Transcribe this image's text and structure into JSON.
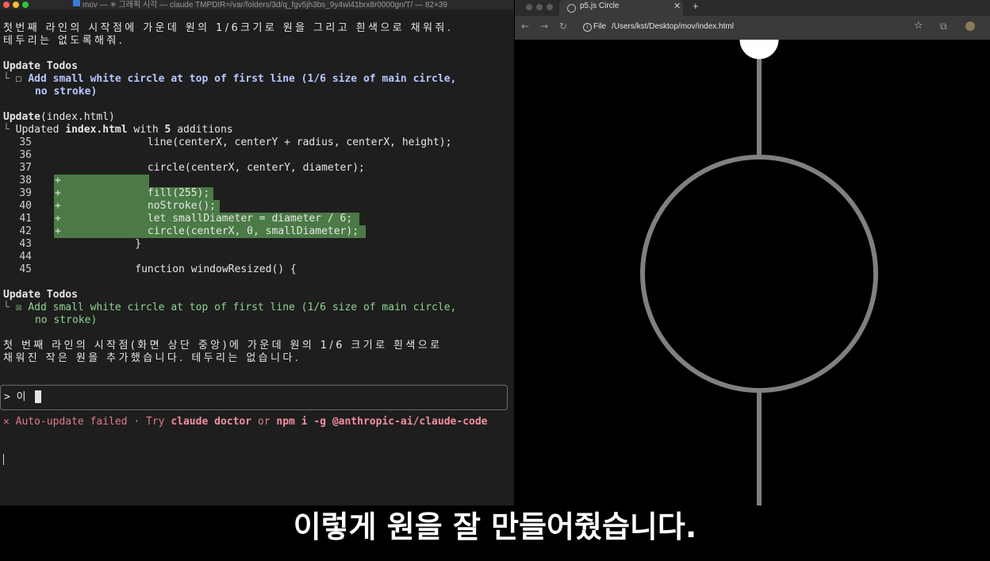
{
  "terminal": {
    "title": "mov — ✳ 그래픽 시각 — claude TMPDIR=/var/folders/3d/q_fgv5jh3bs_9y4wl41brx8r0000gn/T/ — 82×39",
    "request_line1": "첫번째 라인의 시작점에 가운데 원의 1/6크기로 원을 그리고 흰색으로 채워줘.",
    "request_line2": "테두리는 없도록해줘.",
    "todos1_header": "Update Todos",
    "todos1_box": "☐",
    "todos1_item_line1": "Add small white circle at top of first line (1/6 size of main circle,",
    "todos1_item_line2": "no stroke)",
    "update_label": "Update",
    "update_file": "(index.html)",
    "updated_prefix": "Updated",
    "updated_file": "index.html",
    "updated_with": "with",
    "updated_count": "5",
    "updated_suffix": "additions",
    "diff": [
      {
        "num": "35",
        "code": "            line(centerX, centerY + radius, centerX, height);",
        "added": false
      },
      {
        "num": "36",
        "code": "",
        "added": false
      },
      {
        "num": "37",
        "code": "            circle(centerX, centerY, diameter);",
        "added": false
      },
      {
        "num": "38",
        "code": "",
        "added": true
      },
      {
        "num": "39",
        "code": "            fill(255);",
        "added": true
      },
      {
        "num": "40",
        "code": "            noStroke();",
        "added": true
      },
      {
        "num": "41",
        "code": "            let smallDiameter = diameter / 6;",
        "added": true
      },
      {
        "num": "42",
        "code": "            circle(centerX, 0, smallDiameter);",
        "added": true
      },
      {
        "num": "43",
        "code": "          }",
        "added": false
      },
      {
        "num": "44",
        "code": "",
        "added": false
      },
      {
        "num": "45",
        "code": "          function windowResized() {",
        "added": false
      }
    ],
    "todos2_header": "Update Todos",
    "todos2_box": "☒",
    "todos2_item_line1": "Add small white circle at top of first line (1/6 size of main circle,",
    "todos2_item_line2": "no stroke)",
    "answer_line1": "첫 번째 라인의 시작점(화면 상단 중앙)에 가운데 원의 1/6 크기로 흰색으로",
    "answer_line2": "채워진 작은 원을 추가했습니다. 테두리는 없습니다.",
    "prompt": "> 이",
    "err_prefix": "✕ Auto-update failed · Try ",
    "err_cmd1": "claude doctor",
    "err_or": " or ",
    "err_cmd2": "npm i -g @anthropic-ai/claude-code"
  },
  "browser": {
    "tab_title": "p5.js Circle",
    "tab_close": "✕",
    "new_tab": "+",
    "back": "←",
    "forward": "→",
    "reload": "↻",
    "info": "i",
    "file_label": "File",
    "url": "/Users/kst/Desktop/mov/index.html",
    "star": "☆",
    "extensions": "⧉"
  },
  "colors": {
    "traffic_red": "#ff5f57",
    "traffic_yellow": "#febc2e",
    "traffic_green": "#28c840",
    "diff_added_bg": "#4b7a46",
    "canvas_bg": "#000000",
    "stroke_gray": "#808080",
    "small_circle": "#ffffff",
    "error": "#e07a8a"
  },
  "subtitle": "이렇게 원을 잘 만들어줬습니다."
}
